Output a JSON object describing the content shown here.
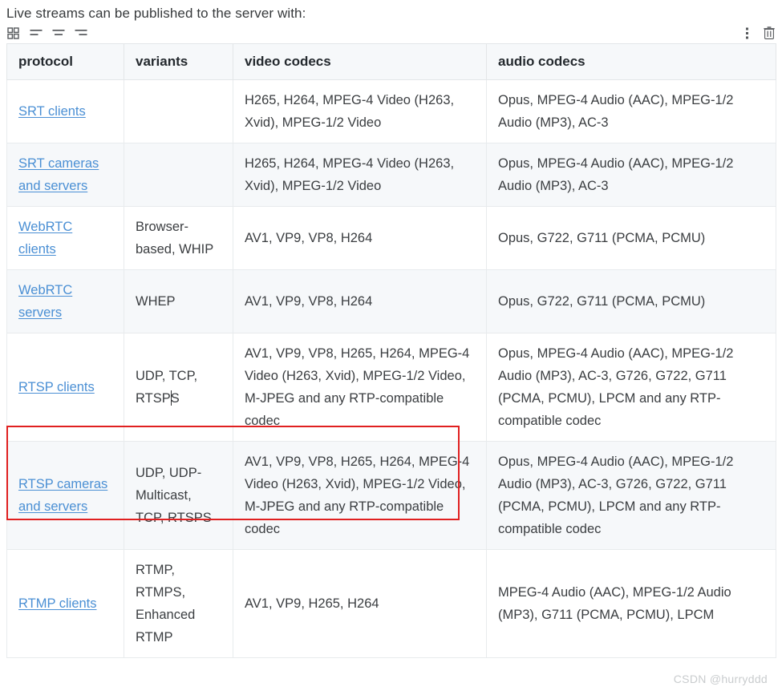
{
  "intro": {
    "text": "Live streams can be published to the server with:"
  },
  "toolbar": {
    "left_items": [
      {
        "name": "table-grid-icon",
        "label": "Table layout"
      },
      {
        "name": "align-left-icon",
        "label": "Align left"
      },
      {
        "name": "align-center-icon",
        "label": "Align center"
      },
      {
        "name": "align-right-icon",
        "label": "Align right"
      }
    ],
    "right_items": [
      {
        "name": "more-options-icon",
        "label": "More options"
      },
      {
        "name": "delete-table-icon",
        "label": "Delete table"
      }
    ]
  },
  "table": {
    "headers": [
      "protocol",
      "variants",
      "video codecs",
      "audio codecs"
    ],
    "rows": [
      {
        "protocol": "SRT clients",
        "protocol_is_link": true,
        "variants": "",
        "video": "H265, H264, MPEG-4 Video (H263, Xvid), MPEG-1/2 Video",
        "audio": "Opus, MPEG-4 Audio (AAC), MPEG-1/2 Audio (MP3), AC-3",
        "shaded": false,
        "selected": false
      },
      {
        "protocol": "SRT cameras and servers",
        "protocol_is_link": true,
        "variants": "",
        "video": "H265, H264, MPEG-4 Video (H263, Xvid), MPEG-1/2 Video",
        "audio": "Opus, MPEG-4 Audio (AAC), MPEG-1/2 Audio (MP3), AC-3",
        "shaded": true,
        "selected": false
      },
      {
        "protocol": "WebRTC clients",
        "protocol_is_link": true,
        "variants": "Browser-based, WHIP",
        "video": "AV1, VP9, VP8, H264",
        "audio": "Opus, G722, G711 (PCMA, PCMU)",
        "shaded": false,
        "selected": false
      },
      {
        "protocol": "WebRTC servers",
        "protocol_is_link": true,
        "variants": "WHEP",
        "video": "AV1, VP9, VP8, H264",
        "audio": "Opus, G722, G711 (PCMA, PCMU)",
        "shaded": true,
        "selected": false
      },
      {
        "protocol": "RTSP clients",
        "protocol_is_link": true,
        "variants_before_caret": "UDP, TCP, RTSP",
        "variants_after_caret": "S",
        "variants": "UDP, TCP, RTSPS",
        "video": "AV1, VP9, VP8, H265, H264, MPEG-4 Video (H263, Xvid), MPEG-1/2 Video, M-JPEG and any RTP-compatible codec",
        "audio": "Opus, MPEG-4 Audio (AAC), MPEG-1/2 Audio (MP3), AC-3, G726, G722, G711 (PCMA, PCMU), LPCM and any RTP-compatible codec",
        "shaded": false,
        "selected": true
      },
      {
        "protocol": "RTSP cameras and servers",
        "protocol_is_link": true,
        "variants": "UDP, UDP-Multicast, TCP, RTSPS",
        "video": "AV1, VP9, VP8, H265, H264, MPEG-4 Video (H263, Xvid), MPEG-1/2 Video, M-JPEG and any RTP-compatible codec",
        "audio": "Opus, MPEG-4 Audio (AAC), MPEG-1/2 Audio (MP3), AC-3, G726, G722, G711 (PCMA, PCMU), LPCM and any RTP-compatible codec",
        "shaded": true,
        "selected": false
      },
      {
        "protocol": "RTMP clients",
        "protocol_is_link": true,
        "variants": "RTMP, RTMPS, Enhanced RTMP",
        "video": "AV1, VP9, H265, H264",
        "audio": "MPEG-4 Audio (AAC), MPEG-1/2 Audio (MP3), G711 (PCMA, PCMU), LPCM",
        "shaded": false,
        "selected": false
      }
    ]
  },
  "watermark": {
    "text": "CSDN @hurryddd"
  },
  "colors": {
    "link": "#4a8fd4",
    "selection_border": "#e02020",
    "row_shaded": "#f6f8fa",
    "table_border": "#e3e6e8"
  }
}
